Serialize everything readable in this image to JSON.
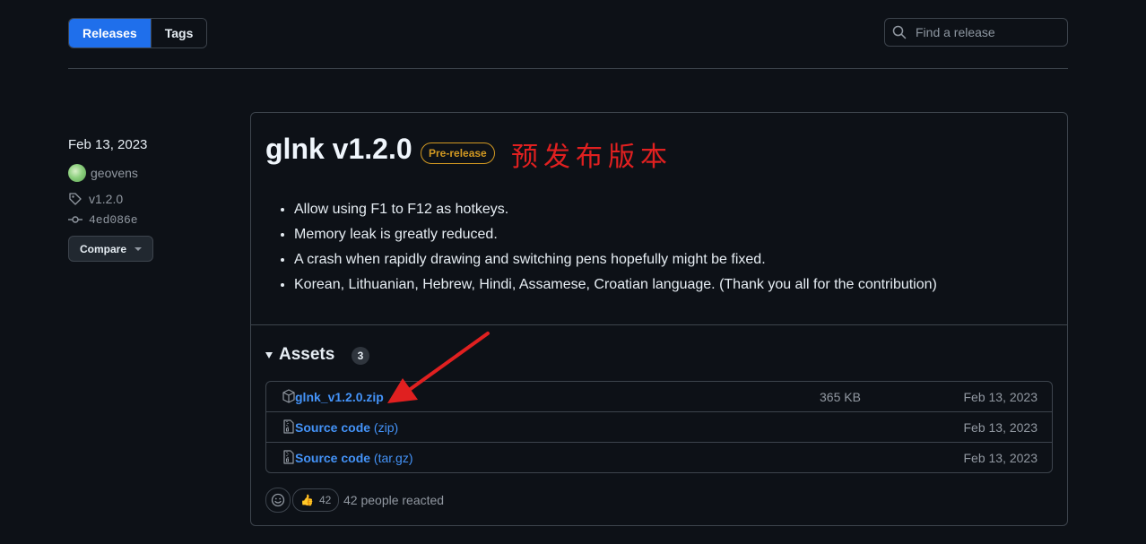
{
  "tabs": [
    {
      "label": "Releases",
      "active": true
    },
    {
      "label": "Tags",
      "active": false
    }
  ],
  "search": {
    "placeholder": "Find a release"
  },
  "release": {
    "date": "Feb 13, 2023",
    "author": "geovens",
    "tag": "v1.2.0",
    "commit": "4ed086e",
    "compare_label": "Compare",
    "title": "glnk v1.2.0",
    "badge": "Pre-release",
    "annotation": "预发布版本",
    "notes": [
      "Allow using F1 to F12 as hotkeys.",
      "Memory leak is greatly reduced.",
      "A crash when rapidly drawing and switching pens hopefully might be fixed.",
      "Korean, Lithuanian, Hebrew, Hindi, Assamese, Croatian language. (Thank you all for the contribution)"
    ],
    "assets_title": "Assets",
    "assets_count": "3",
    "assets": [
      {
        "name": "glnk_v1.2.0.zip",
        "ext": "",
        "size": "365 KB",
        "date": "Feb 13, 2023",
        "icon": "package-icon"
      },
      {
        "name": "Source code",
        "ext": " (zip)",
        "size": "",
        "date": "Feb 13, 2023",
        "icon": "file-zip-icon"
      },
      {
        "name": "Source code",
        "ext": " (tar.gz)",
        "size": "",
        "date": "Feb 13, 2023",
        "icon": "file-zip-icon"
      }
    ],
    "reactions": {
      "count": "42",
      "text": "42 people reacted",
      "emoji": "👍"
    }
  },
  "colors": {
    "accent": "#1f6feb",
    "link": "#4493f8",
    "prerelease": "#d29922",
    "annotation": "#e02020",
    "background": "#0d1117"
  }
}
